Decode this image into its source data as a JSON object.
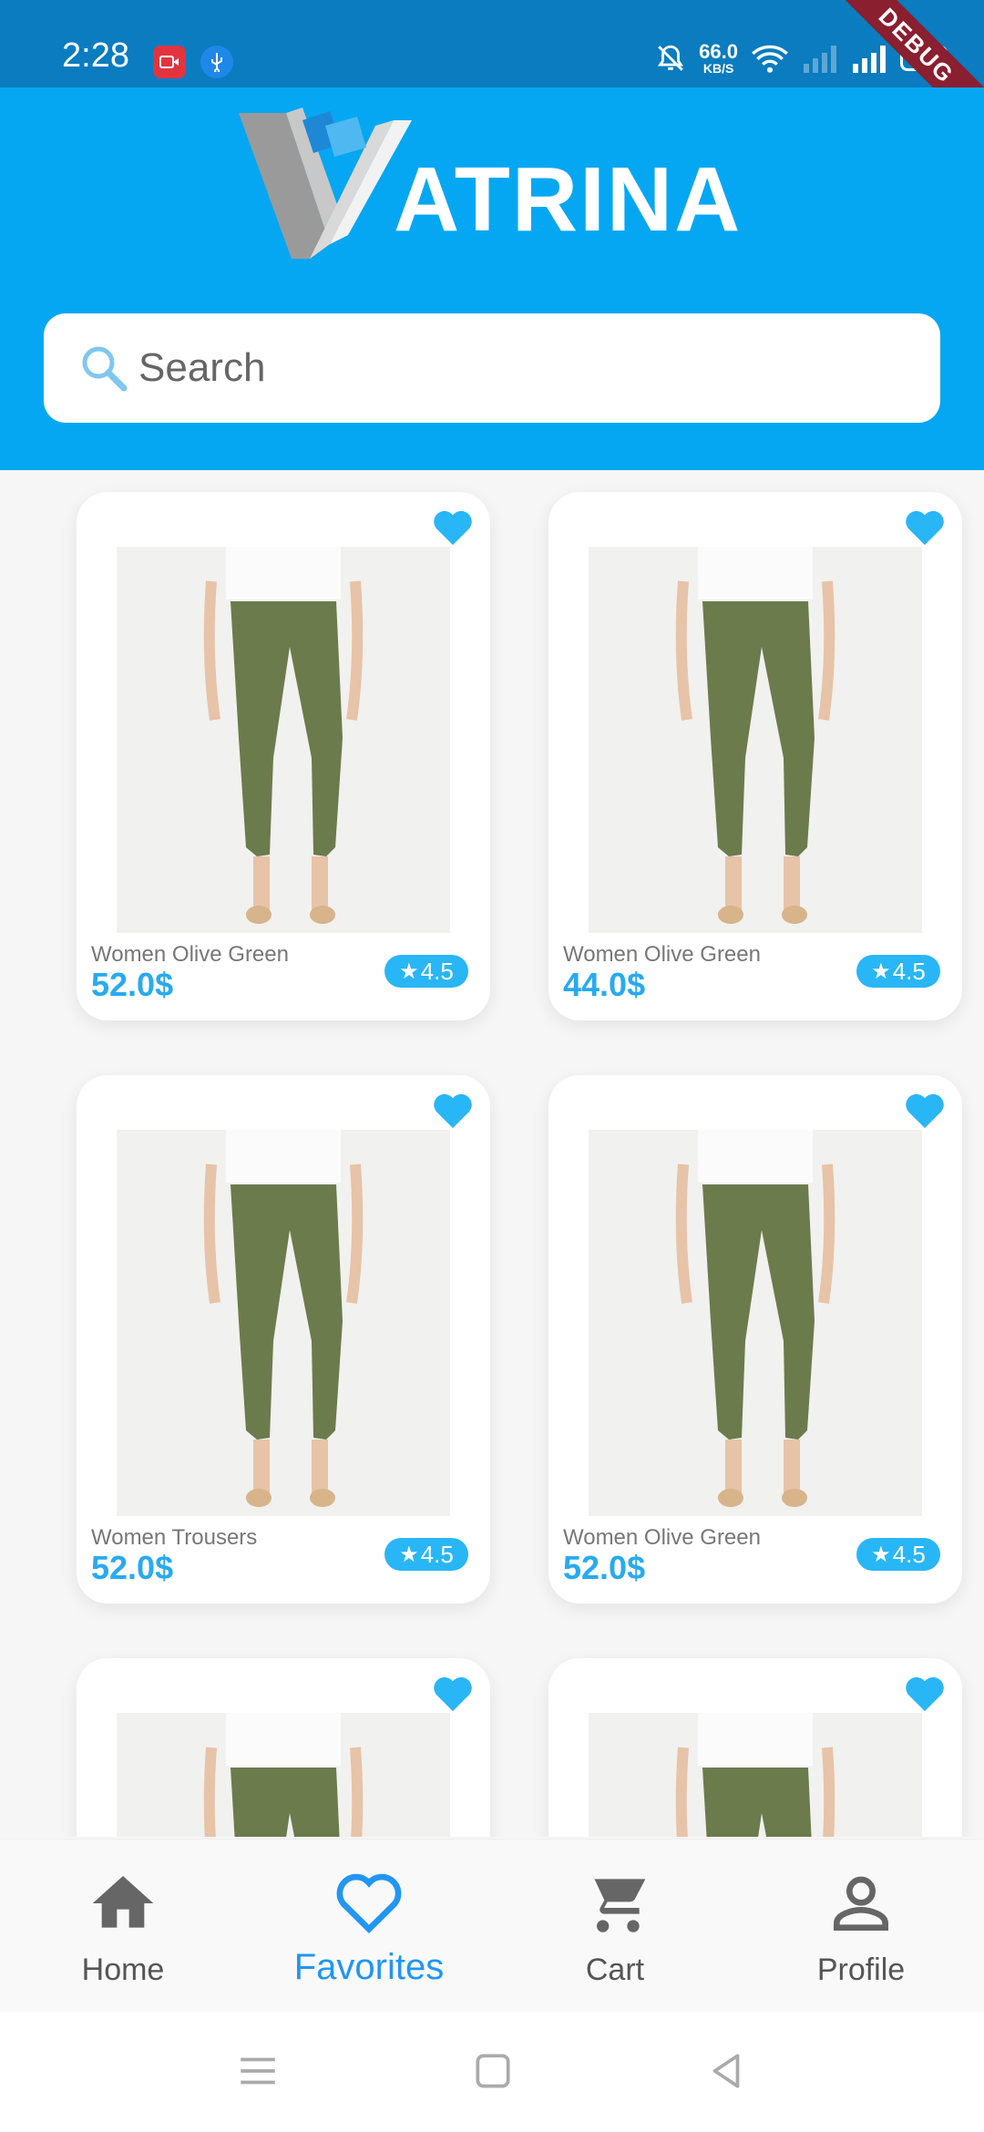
{
  "status_bar": {
    "time": "2:28",
    "net_speed_value": "66.0",
    "net_speed_unit": "KB/S",
    "battery": "63",
    "icons": [
      "screen-record-icon",
      "usb-icon",
      "bell-off-icon",
      "wifi-icon",
      "signal-icon",
      "battery-icon"
    ]
  },
  "debug_banner": "DEBUG",
  "header": {
    "logo_text": "ATRINA",
    "search": {
      "placeholder": "Search",
      "value": ""
    }
  },
  "products": [
    {
      "name": "Women Olive Green",
      "price": "52.0$",
      "rating": "4.5",
      "favorited": true
    },
    {
      "name": "Women Olive Green",
      "price": "44.0$",
      "rating": "4.5",
      "favorited": true
    },
    {
      "name": "Women Trousers",
      "price": "52.0$",
      "rating": "4.5",
      "favorited": true
    },
    {
      "name": "Women Olive Green",
      "price": "52.0$",
      "rating": "4.5",
      "favorited": true
    },
    {
      "name": "",
      "price": "",
      "rating": "",
      "favorited": true
    },
    {
      "name": "",
      "price": "",
      "rating": "",
      "favorited": true
    }
  ],
  "bottom_nav": {
    "items": [
      {
        "label": "Home",
        "icon": "home-icon",
        "active": false
      },
      {
        "label": "Favorites",
        "icon": "heart-outline-icon",
        "active": true
      },
      {
        "label": "Cart",
        "icon": "cart-icon",
        "active": false
      },
      {
        "label": "Profile",
        "icon": "person-icon",
        "active": false
      }
    ]
  },
  "colors": {
    "header": "#05a7f2",
    "status_bar": "#0a7cbf",
    "accent": "#29b6f6",
    "price": "#29aaf0",
    "active_nav": "#2196f3"
  }
}
